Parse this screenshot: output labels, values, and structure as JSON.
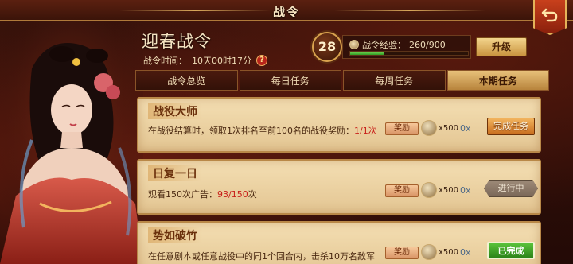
{
  "header": {
    "title": "战令",
    "back_icon": "back-arrow-icon"
  },
  "season": {
    "name": "迎春战令",
    "time_label": "战令时间：",
    "time_value": "10天00时17分",
    "help": "?"
  },
  "level": {
    "value": "28",
    "exp_label": "战令经验：",
    "exp_current": 260,
    "exp_total": 900,
    "exp_text": "260/900",
    "upgrade_label": "升级"
  },
  "tabs": [
    {
      "label": "战令总览",
      "active": false
    },
    {
      "label": "每日任务",
      "active": false
    },
    {
      "label": "每周任务",
      "active": false
    },
    {
      "label": "本期任务",
      "active": true
    }
  ],
  "tasks": [
    {
      "title": "战役大师",
      "desc": "在战役结算时，领取1次排名至前100名的战役奖励：",
      "progress": "1/1次",
      "reward_tag": "奖励",
      "reward_amount": "x500",
      "reward_extra": "0x",
      "action": "完成任务"
    },
    {
      "title": "日复一日",
      "desc": "观看150次广告：",
      "progress": "93/150",
      "progress_suffix": "次",
      "reward_tag": "奖励",
      "reward_amount": "x500",
      "reward_extra": "0x",
      "action": "进行中"
    },
    {
      "title": "势如破竹",
      "desc": "在任意剧本或任意战役中的同1个回合内，击杀10万名敌军",
      "reward_tag": "奖励",
      "reward_amount": "x500",
      "reward_extra": "0x",
      "action": "已完成"
    }
  ],
  "colors": {
    "accent_gold": "#e8c17a",
    "progress_red": "#c8201a",
    "done_green": "#2c8419",
    "exp_green": "#2d9a23"
  }
}
